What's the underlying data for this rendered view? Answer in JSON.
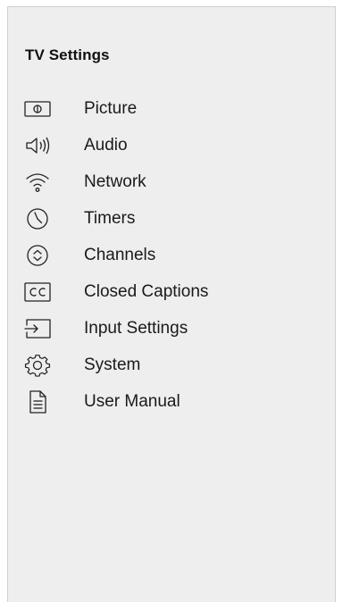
{
  "panel": {
    "title": "TV Settings"
  },
  "menu": {
    "items": [
      {
        "label": "Picture",
        "icon": "picture-icon"
      },
      {
        "label": "Audio",
        "icon": "audio-icon"
      },
      {
        "label": "Network",
        "icon": "wifi-icon"
      },
      {
        "label": "Timers",
        "icon": "clock-icon"
      },
      {
        "label": "Channels",
        "icon": "channels-icon"
      },
      {
        "label": "Closed Captions",
        "icon": "cc-icon"
      },
      {
        "label": "Input Settings",
        "icon": "input-icon"
      },
      {
        "label": "System",
        "icon": "gear-icon"
      },
      {
        "label": "User Manual",
        "icon": "document-icon"
      }
    ]
  },
  "colors": {
    "panel_background": "#eeeeee",
    "text": "#111111"
  }
}
